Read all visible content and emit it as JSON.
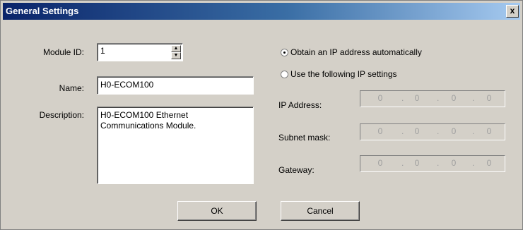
{
  "window": {
    "title": "General Settings",
    "close_label": "x"
  },
  "module_id": {
    "label": "Module ID:",
    "value": "1"
  },
  "name": {
    "label": "Name:",
    "value": "H0-ECOM100"
  },
  "description": {
    "label": "Description:",
    "value": "H0-ECOM100 Ethernet\nCommunications Module."
  },
  "ip_mode": {
    "auto_label": "Obtain an IP address automatically",
    "manual_label": "Use the following IP settings",
    "selected": "auto"
  },
  "ip_address": {
    "label": "IP Address:",
    "octets": [
      "0",
      "0",
      "0",
      "0"
    ]
  },
  "subnet_mask": {
    "label": "Subnet mask:",
    "octets": [
      "0",
      "0",
      "0",
      "0"
    ]
  },
  "gateway": {
    "label": "Gateway:",
    "octets": [
      "0",
      "0",
      "0",
      "0"
    ]
  },
  "buttons": {
    "ok_label": "OK",
    "cancel_label": "Cancel"
  },
  "separator": "."
}
